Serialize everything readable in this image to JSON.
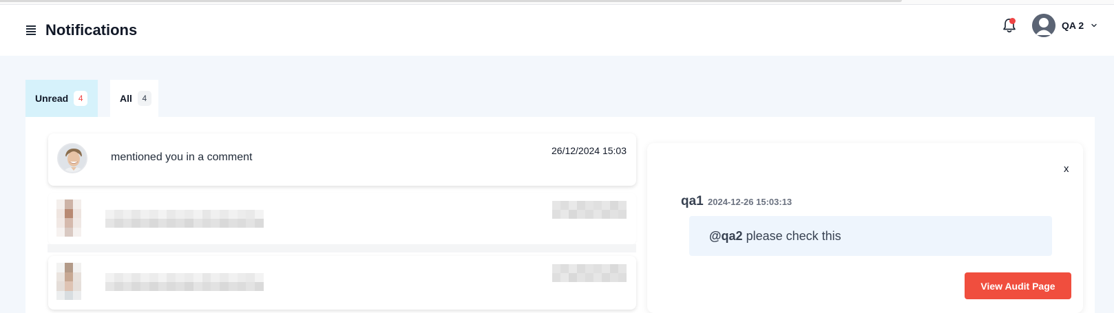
{
  "header": {
    "title": "Notifications",
    "user_name": "QA 2",
    "icons": {
      "menu": "menu-icon",
      "bell": "bell-icon",
      "chevron": "chevron-down-icon"
    }
  },
  "tabs": [
    {
      "label": "Unread",
      "count": "4",
      "active": true
    },
    {
      "label": "All",
      "count": "4",
      "active": false
    }
  ],
  "notifications": [
    {
      "text": "mentioned you in a comment",
      "time": "26/12/2024 15:03",
      "blurred": false
    },
    {
      "text": "",
      "time": "",
      "blurred": true
    },
    {
      "text": "",
      "time": "",
      "blurred": true
    }
  ],
  "detail": {
    "close_label": "x",
    "author": "qa1",
    "timestamp": "2024-12-26 15:03:13",
    "mention": "@qa2",
    "message": " please check this",
    "action_label": "View Audit Page"
  },
  "colors": {
    "accent": "#f04e3e",
    "active_tab": "#d6f2fb",
    "unread_badge": "#ef4444",
    "comment_bg": "#eef5fd"
  }
}
